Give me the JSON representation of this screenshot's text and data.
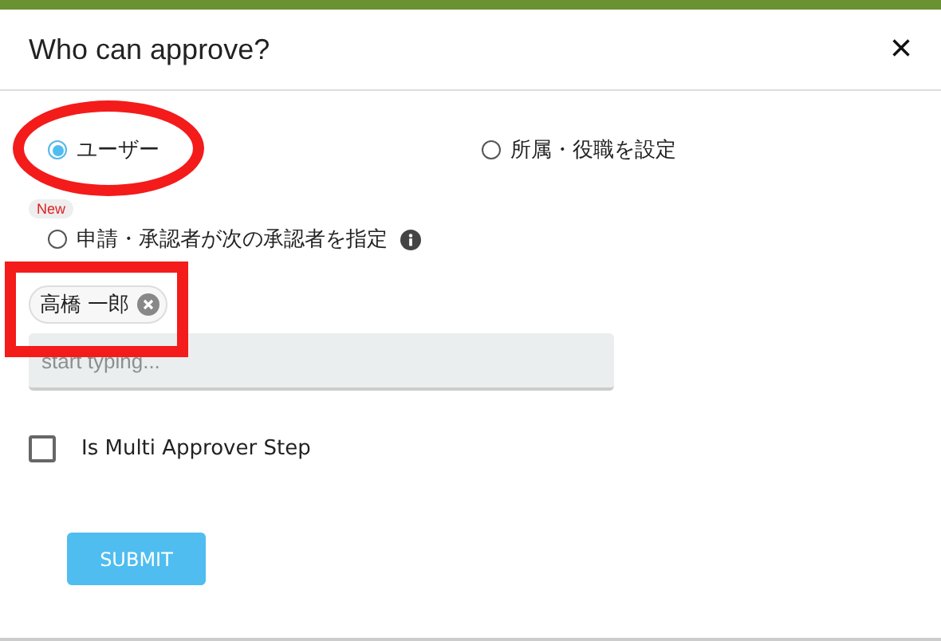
{
  "dialog": {
    "title": "Who can approve?",
    "close": "×"
  },
  "options": [
    {
      "label": "ユーザー",
      "selected": true
    },
    {
      "label": "所属・役職を設定",
      "selected": false
    },
    {
      "label": "申請・承認者が次の承認者を指定",
      "selected": false,
      "badge": "New",
      "info": true
    }
  ],
  "chips": [
    {
      "label": "高橋 一郎"
    }
  ],
  "search": {
    "placeholder": "start typing..."
  },
  "multi_step": {
    "label": "Is Multi Approver Step",
    "checked": false
  },
  "submit": "SUBMIT"
}
